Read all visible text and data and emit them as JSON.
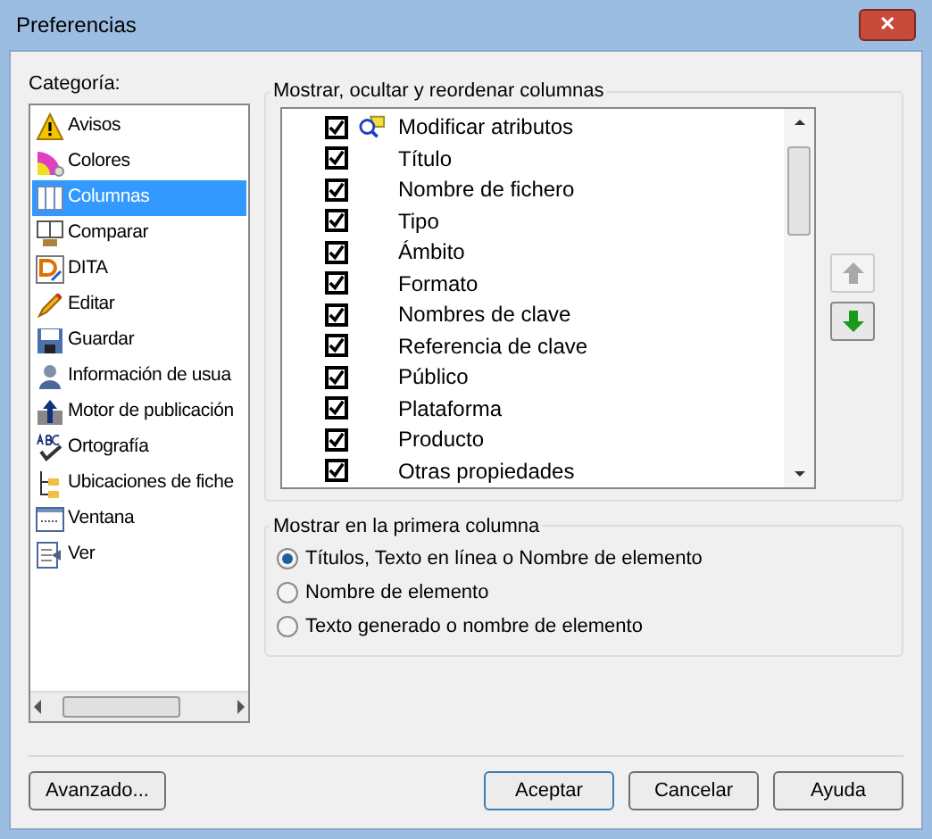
{
  "window": {
    "title": "Preferencias",
    "close": "✕"
  },
  "category_label": "Categoría:",
  "sidebar": {
    "items": [
      {
        "label": "Avisos",
        "selected": false
      },
      {
        "label": "Colores",
        "selected": false
      },
      {
        "label": "Columnas",
        "selected": true
      },
      {
        "label": "Comparar",
        "selected": false
      },
      {
        "label": "DITA",
        "selected": false
      },
      {
        "label": "Editar",
        "selected": false
      },
      {
        "label": "Guardar",
        "selected": false
      },
      {
        "label": "Información de usua",
        "selected": false
      },
      {
        "label": "Motor de publicación",
        "selected": false
      },
      {
        "label": "Ortografía",
        "selected": false
      },
      {
        "label": "Ubicaciones de fiche",
        "selected": false
      },
      {
        "label": "Ventana",
        "selected": false
      },
      {
        "label": "Ver",
        "selected": false
      }
    ]
  },
  "columns_group": {
    "title": "Mostrar, ocultar y reordenar columnas",
    "items": [
      {
        "label": "Modificar atributos",
        "checked": true
      },
      {
        "label": "Título",
        "checked": true
      },
      {
        "label": "Nombre de fichero",
        "checked": true
      },
      {
        "label": "Tipo",
        "checked": true
      },
      {
        "label": "Ámbito",
        "checked": true
      },
      {
        "label": "Formato",
        "checked": true
      },
      {
        "label": "Nombres de clave",
        "checked": true
      },
      {
        "label": "Referencia de clave",
        "checked": true
      },
      {
        "label": "Público",
        "checked": true
      },
      {
        "label": "Plataforma",
        "checked": true
      },
      {
        "label": "Producto",
        "checked": true
      },
      {
        "label": "Otras propiedades",
        "checked": true
      }
    ],
    "move_up": {
      "disabled": true
    },
    "move_down": {
      "disabled": false
    }
  },
  "first_column_group": {
    "title": "Mostrar en la primera columna",
    "options": [
      {
        "label": "Títulos, Texto en línea o Nombre de elemento",
        "selected": true
      },
      {
        "label": "Nombre de elemento",
        "selected": false
      },
      {
        "label": "Texto generado o nombre de elemento",
        "selected": false
      }
    ]
  },
  "buttons": [
    {
      "label": "Avanzado...",
      "kind": "left",
      "default": false
    },
    {
      "label": "Aceptar",
      "kind": "right",
      "default": true
    },
    {
      "label": "Cancelar",
      "kind": "right",
      "default": false
    },
    {
      "label": "Ayuda",
      "kind": "right",
      "default": false
    }
  ]
}
